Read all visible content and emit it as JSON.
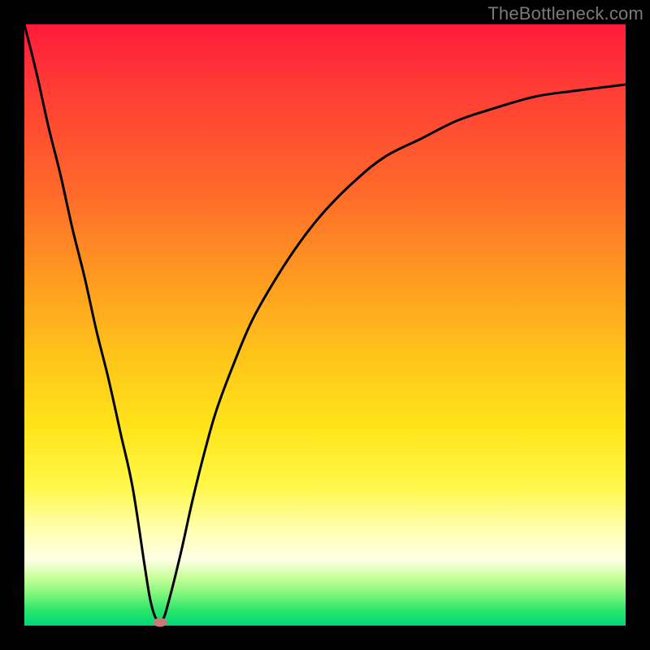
{
  "chart_data": {
    "type": "line",
    "title": "",
    "xlabel": "",
    "ylabel": "",
    "xlim": [
      0,
      100
    ],
    "ylim": [
      0,
      100
    ],
    "series": [
      {
        "name": "bottleneck-curve",
        "x": [
          0,
          2,
          4,
          6,
          8,
          10,
          12,
          14,
          16,
          18,
          20,
          21,
          22,
          23,
          24,
          26,
          28,
          30,
          32,
          35,
          38,
          42,
          46,
          50,
          55,
          60,
          66,
          72,
          78,
          85,
          92,
          100
        ],
        "y": [
          100,
          92,
          83,
          75,
          66,
          58,
          49,
          41,
          32,
          23,
          10,
          4,
          1,
          1,
          4,
          12,
          21,
          29,
          36,
          44,
          51,
          58,
          64,
          69,
          74,
          78,
          81,
          84,
          86,
          88,
          89,
          90
        ]
      }
    ],
    "marker": {
      "x": 22.5,
      "y": 0.5,
      "color": "#c97a78"
    },
    "gradient_stops": [
      {
        "pos": 0,
        "color": "#ff1a3a"
      },
      {
        "pos": 28,
        "color": "#ff6a2a"
      },
      {
        "pos": 55,
        "color": "#ffc41a"
      },
      {
        "pos": 77,
        "color": "#fff84a"
      },
      {
        "pos": 89,
        "color": "#ffffe6"
      },
      {
        "pos": 95,
        "color": "#78f47a"
      },
      {
        "pos": 100,
        "color": "#00d87a"
      }
    ],
    "legend": null,
    "grid": false
  },
  "watermark": "TheBottleneck.com"
}
